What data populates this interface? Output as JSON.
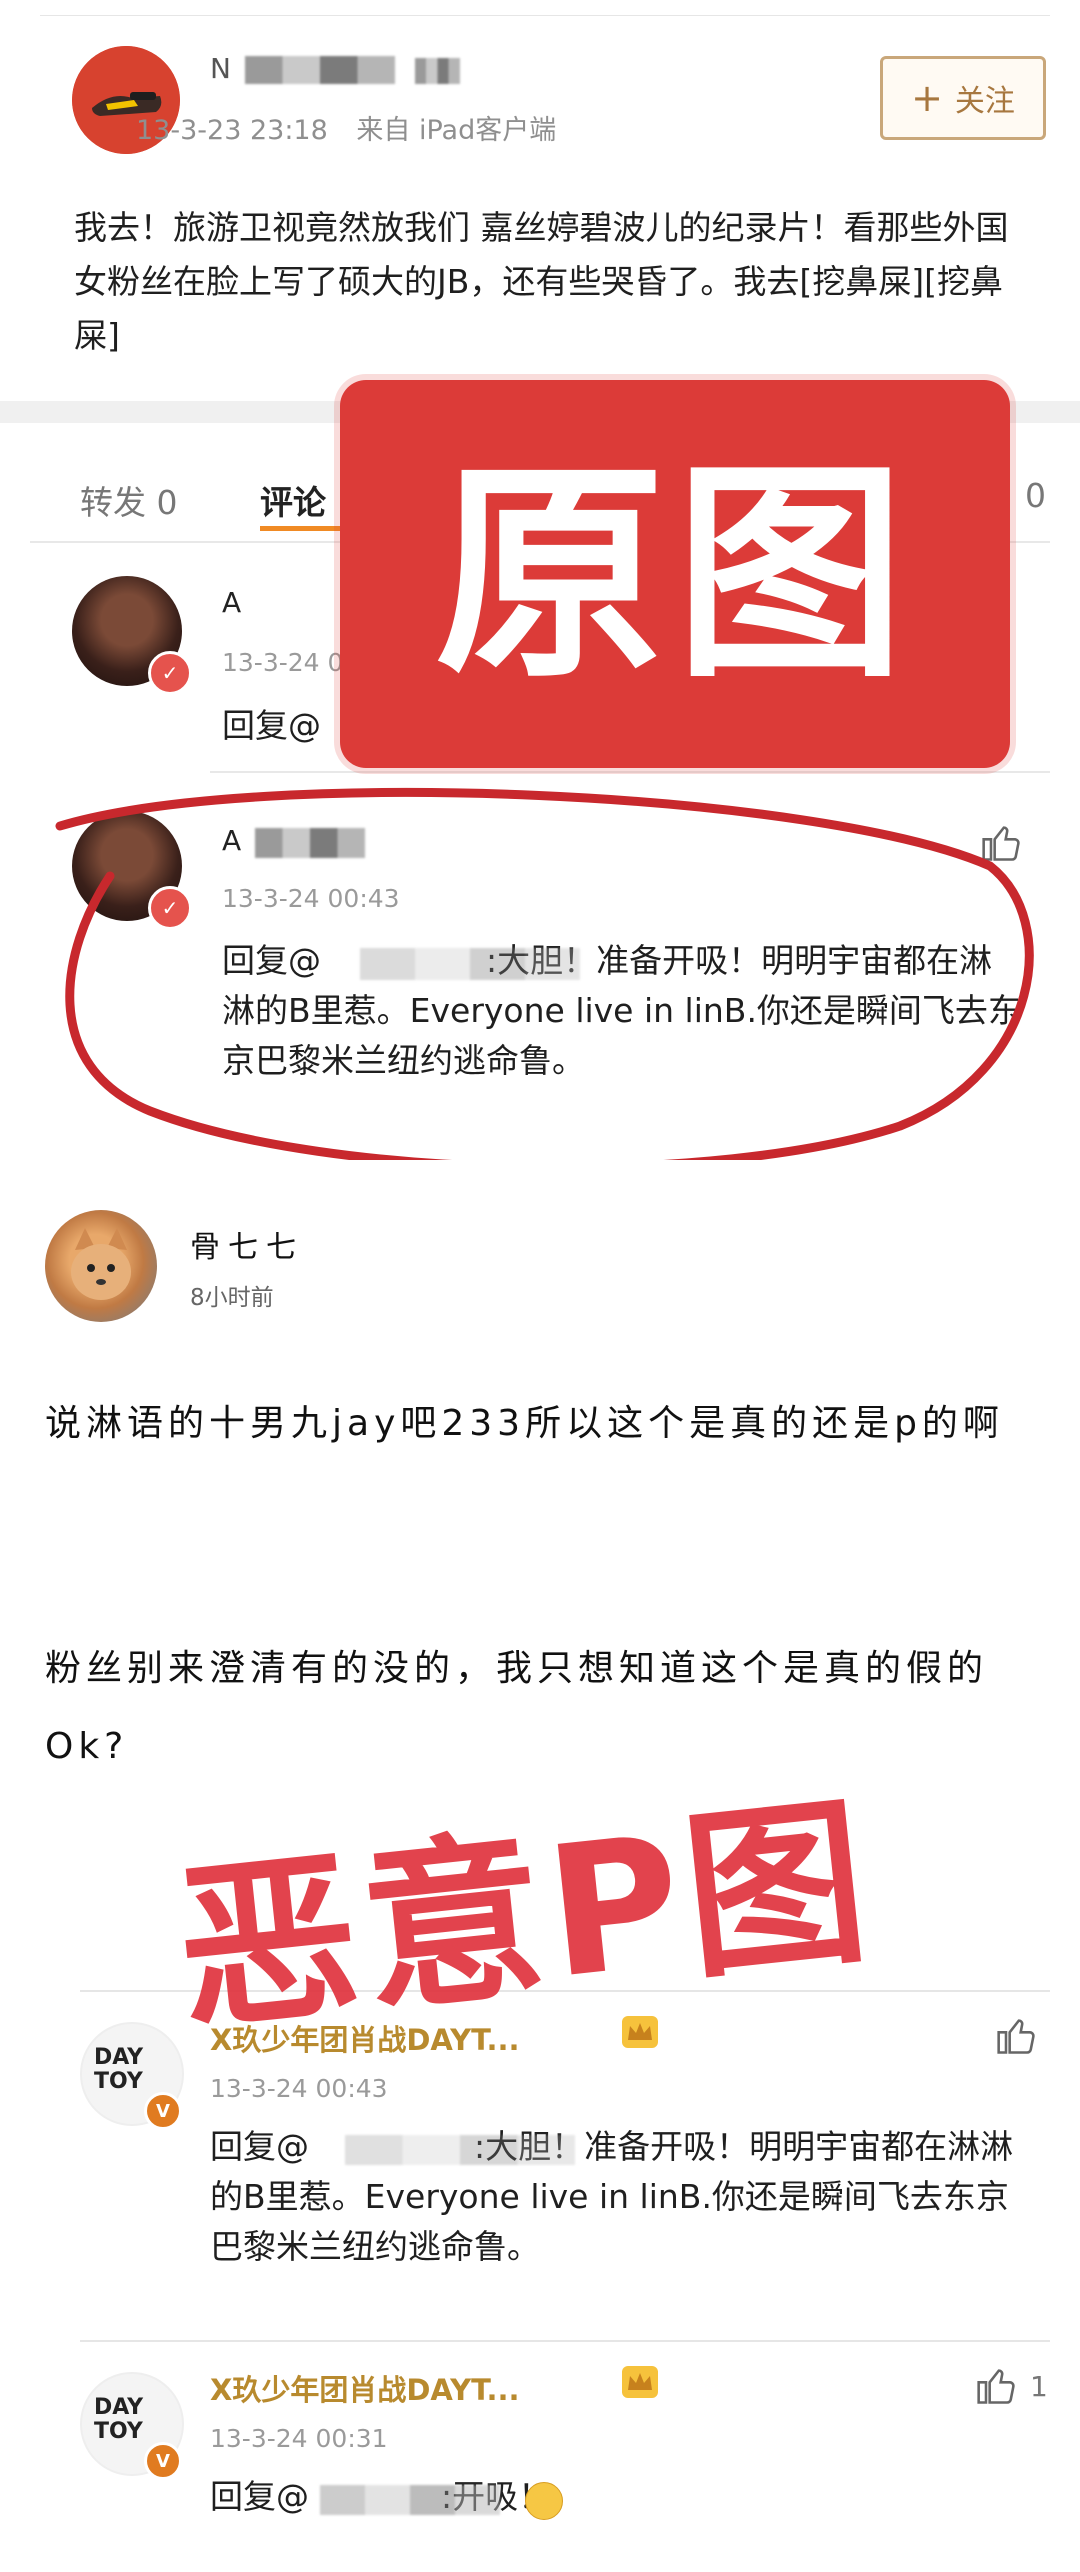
{
  "top_post": {
    "author_name": "N",
    "timestamp": "13-3-23 23:18",
    "source": "来自 iPad客户端",
    "follow_label": "关注",
    "text": "我去！旅游卫视竟然放我们 嘉丝婷碧波儿的纪录片！看那些外国女粉丝在脸上写了硕大的JB，还有些哭昏了。我去[挖鼻屎][挖鼻屎]",
    "tabs": {
      "repost": "转发 0",
      "comment": "评论",
      "like_count": "0"
    },
    "comment1": {
      "name": "A",
      "time": "13-3-24 0",
      "text": "回复@"
    },
    "comment2": {
      "name": "A",
      "time": "13-3-24 00:43",
      "text": "回复@　　　　　:大胆！准备开吸！明明宇宙都在淋淋的B里惹。Everyone live in linB.你还是瞬间飞去东京巴黎米兰纽约逃命鲁。"
    }
  },
  "overlay_label": "原图",
  "second_post": {
    "author_name": "骨七七",
    "time_ago": "8小时前",
    "para1": "说淋语的十男九jay吧233所以这个是真的还是p的啊",
    "para2": "粉丝别来澄清有的没的，我只想知道这个是真的假的Ok?",
    "stamp": "恶意P图",
    "quote1": {
      "name": "X玖少年团肖战DAYT...",
      "time": "13-3-24 00:43",
      "text": "回复@　　　　　:大胆！准备开吸！明明宇宙都在淋淋的B里惹。Everyone live in linB.你还是瞬间飞去东京巴黎米兰纽约逃命鲁。"
    },
    "quote2": {
      "name": "X玖少年团肖战DAYT...",
      "time": "13-3-24 00:31",
      "text": "回复@　　　　:开吸！",
      "like_count": "1"
    },
    "logo_text": "DAY TOY"
  },
  "colors": {
    "accent_red": "#dc3b38",
    "gold": "#b88a2e",
    "follow_border": "#c9a77a"
  },
  "icons": [
    "plus-icon",
    "thumbs-up-icon",
    "crown-icon",
    "verified-badge-icon",
    "thinking-emoji-icon"
  ]
}
